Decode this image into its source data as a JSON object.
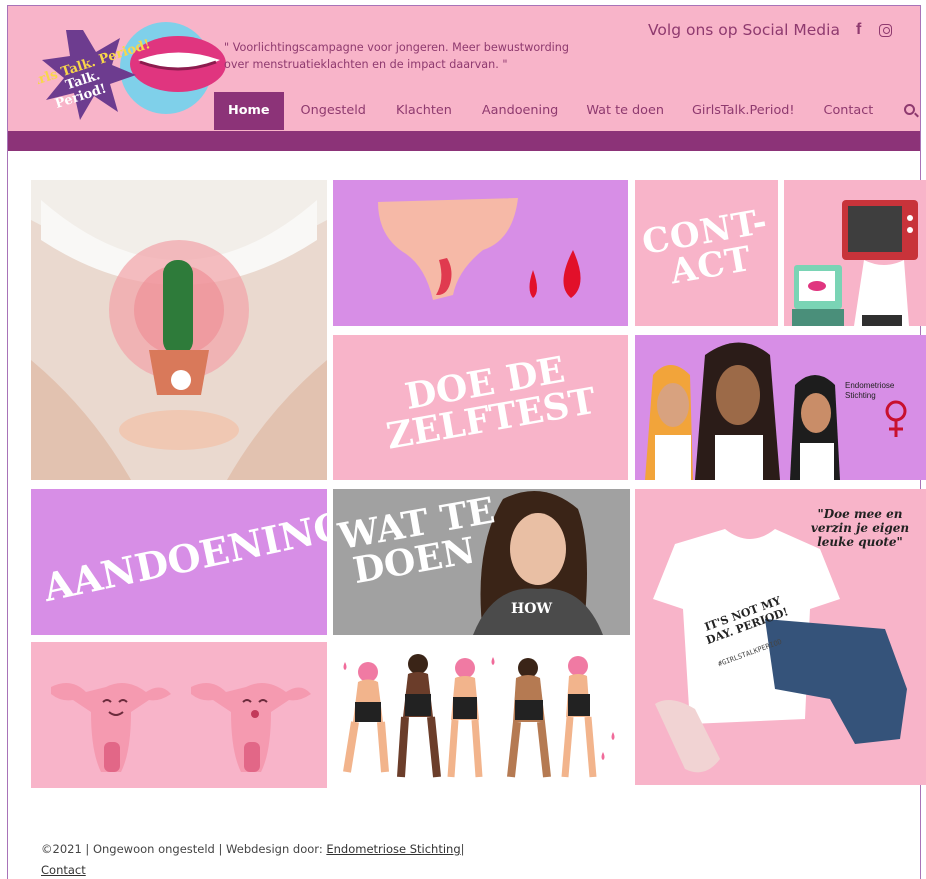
{
  "header": {
    "logo_text": "Girls Talk. Period!",
    "tagline": "\" Voorlichtingscampagne voor jongeren. Meer bewustwording over menstruatieklachten en de impact daarvan. \"",
    "social_label": "Volg ons op Social Media",
    "social_icons": [
      "facebook-icon",
      "instagram-icon"
    ]
  },
  "nav": {
    "items": [
      {
        "label": "Home",
        "active": true
      },
      {
        "label": "Ongesteld"
      },
      {
        "label": "Klachten"
      },
      {
        "label": "Aandoening"
      },
      {
        "label": "Wat te doen"
      },
      {
        "label": "GirlsTalk.Period!"
      },
      {
        "label": "Contact"
      }
    ],
    "search_icon": "search-icon"
  },
  "tiles": {
    "contact": "CONT-\nACT",
    "zelftest": "DOE DE\nZELFTEST",
    "aandoening": "AANDOENING",
    "wat_te_doen": "WAT TE\nDOEN",
    "endometriose": "Endometriose Stichting",
    "quote": "\"Doe mee en verzin je eigen leuke quote\"",
    "shirt_text": "IT'S NOT MY DAY. PERIOD!",
    "shirt_tag": "#GIRLSTALKPERIOD",
    "how": "HOW"
  },
  "footer": {
    "text": "©2021 | Ongewoon ongesteld | Webdesign door:",
    "link": "Endometriose Stichting",
    "sep": "|",
    "contact": "Contact"
  },
  "colors": {
    "pink": "#f8b4c9",
    "plum": "#8c3378",
    "lilac": "#d78ee6"
  }
}
